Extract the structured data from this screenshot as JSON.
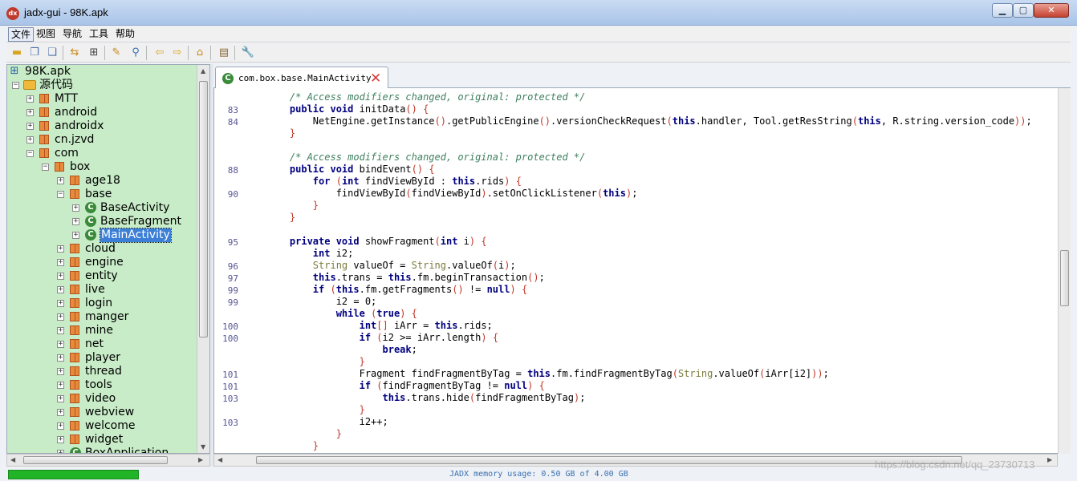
{
  "window": {
    "title": "jadx-gui - 98K.apk",
    "app_icon": "jadx-icon",
    "buttons": {
      "minimize": "▁",
      "maximize": "▢",
      "close": "✕"
    }
  },
  "menu": {
    "items": [
      "文件",
      "视图",
      "导航",
      "工具",
      "帮助"
    ],
    "active": "文件"
  },
  "toolbar": {
    "icons": [
      "open-file-icon",
      "save-all-icon",
      "export-icon",
      "sync-icon",
      "flatten-icon",
      "find-text-icon",
      "search-icon",
      "back-icon",
      "forward-icon",
      "decompile-icon",
      "log-icon",
      "preferences-icon"
    ]
  },
  "tree": {
    "root": "98K.apk",
    "source_folder": "源代码",
    "nodes": [
      {
        "label": "MTT",
        "type": "package",
        "level": 2
      },
      {
        "label": "android",
        "type": "package",
        "level": 2
      },
      {
        "label": "androidx",
        "type": "package",
        "level": 2
      },
      {
        "label": "cn.jzvd",
        "type": "package",
        "level": 2
      },
      {
        "label": "com",
        "type": "package",
        "level": 2,
        "expanded": true
      },
      {
        "label": "box",
        "type": "package",
        "level": 3,
        "expanded": true
      },
      {
        "label": "age18",
        "type": "package",
        "level": 4
      },
      {
        "label": "base",
        "type": "package",
        "level": 4,
        "expanded": true
      },
      {
        "label": "BaseActivity",
        "type": "class",
        "level": 5
      },
      {
        "label": "BaseFragment",
        "type": "class",
        "level": 5
      },
      {
        "label": "MainActivity",
        "type": "class",
        "level": 5,
        "selected": true
      },
      {
        "label": "cloud",
        "type": "package",
        "level": 4
      },
      {
        "label": "engine",
        "type": "package",
        "level": 4
      },
      {
        "label": "entity",
        "type": "package",
        "level": 4
      },
      {
        "label": "live",
        "type": "package",
        "level": 4
      },
      {
        "label": "login",
        "type": "package",
        "level": 4
      },
      {
        "label": "manger",
        "type": "package",
        "level": 4
      },
      {
        "label": "mine",
        "type": "package",
        "level": 4
      },
      {
        "label": "net",
        "type": "package",
        "level": 4
      },
      {
        "label": "player",
        "type": "package",
        "level": 4
      },
      {
        "label": "thread",
        "type": "package",
        "level": 4
      },
      {
        "label": "tools",
        "type": "package",
        "level": 4
      },
      {
        "label": "video",
        "type": "package",
        "level": 4
      },
      {
        "label": "webview",
        "type": "package",
        "level": 4
      },
      {
        "label": "welcome",
        "type": "package",
        "level": 4
      },
      {
        "label": "widget",
        "type": "package",
        "level": 4
      },
      {
        "label": "BoxApplication",
        "type": "class",
        "level": 4
      }
    ]
  },
  "tab": {
    "label": "com.box.base.MainActivity",
    "close_icon": "close-tab-icon"
  },
  "code": [
    {
      "n": "",
      "t": [
        [
          "cm",
          "    /* Access modifiers changed, original: protected */"
        ]
      ]
    },
    {
      "n": "83",
      "t": [
        [
          "",
          "    "
        ],
        [
          "kw",
          "public void"
        ],
        [
          "",
          " initData"
        ],
        [
          "pn",
          "()"
        ],
        [
          "",
          " "
        ],
        [
          "pn",
          "{"
        ]
      ]
    },
    {
      "n": "84",
      "t": [
        [
          "",
          "        NetEngine.getInstance"
        ],
        [
          "pn",
          "()"
        ],
        [
          "",
          ".getPublicEngine"
        ],
        [
          "pn",
          "()"
        ],
        [
          "",
          ".versionCheckRequest"
        ],
        [
          "pn",
          "("
        ],
        [
          "kw",
          "this"
        ],
        [
          "",
          ".handler, Tool.getResString"
        ],
        [
          "pn",
          "("
        ],
        [
          "kw",
          "this"
        ],
        [
          "",
          ", R.string.version_code"
        ],
        [
          "pn",
          "))"
        ],
        [
          "",
          ";"
        ]
      ]
    },
    {
      "n": "",
      "t": [
        [
          "pn",
          "    }"
        ]
      ]
    },
    {
      "n": "",
      "t": [
        [
          "",
          ""
        ]
      ]
    },
    {
      "n": "",
      "t": [
        [
          "cm",
          "    /* Access modifiers changed, original: protected */"
        ]
      ]
    },
    {
      "n": "88",
      "t": [
        [
          "",
          "    "
        ],
        [
          "kw",
          "public void"
        ],
        [
          "",
          " bindEvent"
        ],
        [
          "pn",
          "()"
        ],
        [
          "",
          " "
        ],
        [
          "pn",
          "{"
        ]
      ]
    },
    {
      "n": "",
      "t": [
        [
          "",
          "        "
        ],
        [
          "kw",
          "for"
        ],
        [
          "",
          " "
        ],
        [
          "pn",
          "("
        ],
        [
          "kw",
          "int"
        ],
        [
          "",
          " findViewById : "
        ],
        [
          "kw",
          "this"
        ],
        [
          "",
          ".rids"
        ],
        [
          "pn",
          ")"
        ],
        [
          "",
          " "
        ],
        [
          "pn",
          "{"
        ]
      ]
    },
    {
      "n": "90",
      "t": [
        [
          "",
          "            findViewById"
        ],
        [
          "pn",
          "("
        ],
        [
          "",
          "findViewById"
        ],
        [
          "pn",
          ")"
        ],
        [
          "",
          ".setOnClickListener"
        ],
        [
          "pn",
          "("
        ],
        [
          "kw",
          "this"
        ],
        [
          "pn",
          ")"
        ],
        [
          "",
          ";"
        ]
      ]
    },
    {
      "n": "",
      "t": [
        [
          "pn",
          "        }"
        ]
      ]
    },
    {
      "n": "",
      "t": [
        [
          "pn",
          "    }"
        ]
      ]
    },
    {
      "n": "",
      "t": [
        [
          "",
          ""
        ]
      ]
    },
    {
      "n": "95",
      "t": [
        [
          "",
          "    "
        ],
        [
          "kw",
          "private void"
        ],
        [
          "",
          " showFragment"
        ],
        [
          "pn",
          "("
        ],
        [
          "kw",
          "int"
        ],
        [
          "",
          " i"
        ],
        [
          "pn",
          ")"
        ],
        [
          "",
          " "
        ],
        [
          "pn",
          "{"
        ]
      ]
    },
    {
      "n": "",
      "t": [
        [
          "",
          "        "
        ],
        [
          "kw",
          "int"
        ],
        [
          "",
          " i2;"
        ]
      ]
    },
    {
      "n": "96",
      "t": [
        [
          "",
          "        "
        ],
        [
          "ty",
          "String"
        ],
        [
          "",
          " valueOf = "
        ],
        [
          "ty",
          "String"
        ],
        [
          "",
          ".valueOf"
        ],
        [
          "pn",
          "("
        ],
        [
          "",
          "i"
        ],
        [
          "pn",
          ")"
        ],
        [
          "",
          ";"
        ]
      ]
    },
    {
      "n": "97",
      "t": [
        [
          "",
          "        "
        ],
        [
          "kw",
          "this"
        ],
        [
          "",
          ".trans = "
        ],
        [
          "kw",
          "this"
        ],
        [
          "",
          ".fm.beginTransaction"
        ],
        [
          "pn",
          "()"
        ],
        [
          "",
          ";"
        ]
      ]
    },
    {
      "n": "99",
      "t": [
        [
          "",
          "        "
        ],
        [
          "kw",
          "if"
        ],
        [
          "",
          " "
        ],
        [
          "pn",
          "("
        ],
        [
          "kw",
          "this"
        ],
        [
          "",
          ".fm.getFragments"
        ],
        [
          "pn",
          "()"
        ],
        [
          "",
          " != "
        ],
        [
          "kw",
          "null"
        ],
        [
          "pn",
          ")"
        ],
        [
          "",
          " "
        ],
        [
          "pn",
          "{"
        ]
      ]
    },
    {
      "n": "99",
      "t": [
        [
          "",
          "            i2 = 0;"
        ]
      ]
    },
    {
      "n": "",
      "t": [
        [
          "",
          "            "
        ],
        [
          "kw",
          "while"
        ],
        [
          "",
          " "
        ],
        [
          "pn",
          "("
        ],
        [
          "kw",
          "true"
        ],
        [
          "pn",
          ")"
        ],
        [
          "",
          " "
        ],
        [
          "pn",
          "{"
        ]
      ]
    },
    {
      "n": "100",
      "t": [
        [
          "",
          "                "
        ],
        [
          "kw",
          "int"
        ],
        [
          "pn",
          "[]"
        ],
        [
          "",
          " iArr = "
        ],
        [
          "kw",
          "this"
        ],
        [
          "",
          ".rids;"
        ]
      ]
    },
    {
      "n": "100",
      "t": [
        [
          "",
          "                "
        ],
        [
          "kw",
          "if"
        ],
        [
          "",
          " "
        ],
        [
          "pn",
          "("
        ],
        [
          "",
          "i2 >= iArr.length"
        ],
        [
          "pn",
          ")"
        ],
        [
          "",
          " "
        ],
        [
          "pn",
          "{"
        ]
      ]
    },
    {
      "n": "",
      "t": [
        [
          "",
          "                    "
        ],
        [
          "kw",
          "break"
        ],
        [
          "",
          ";"
        ]
      ]
    },
    {
      "n": "",
      "t": [
        [
          "pn",
          "                }"
        ]
      ]
    },
    {
      "n": "101",
      "t": [
        [
          "",
          "                Fragment findFragmentByTag = "
        ],
        [
          "kw",
          "this"
        ],
        [
          "",
          ".fm.findFragmentByTag"
        ],
        [
          "pn",
          "("
        ],
        [
          "ty",
          "String"
        ],
        [
          "",
          ".valueOf"
        ],
        [
          "pn",
          "("
        ],
        [
          "",
          "iArr[i2]"
        ],
        [
          "pn",
          "))"
        ],
        [
          "",
          ";"
        ]
      ]
    },
    {
      "n": "101",
      "t": [
        [
          "",
          "                "
        ],
        [
          "kw",
          "if"
        ],
        [
          "",
          " "
        ],
        [
          "pn",
          "("
        ],
        [
          "",
          "findFragmentByTag != "
        ],
        [
          "kw",
          "null"
        ],
        [
          "pn",
          ")"
        ],
        [
          "",
          " "
        ],
        [
          "pn",
          "{"
        ]
      ]
    },
    {
      "n": "103",
      "t": [
        [
          "",
          "                    "
        ],
        [
          "kw",
          "this"
        ],
        [
          "",
          ".trans.hide"
        ],
        [
          "pn",
          "("
        ],
        [
          "",
          "findFragmentByTag"
        ],
        [
          "pn",
          ")"
        ],
        [
          "",
          ";"
        ]
      ]
    },
    {
      "n": "",
      "t": [
        [
          "pn",
          "                }"
        ]
      ]
    },
    {
      "n": "103",
      "t": [
        [
          "",
          "                i2++;"
        ]
      ]
    },
    {
      "n": "",
      "t": [
        [
          "pn",
          "            }"
        ]
      ]
    },
    {
      "n": "",
      "t": [
        [
          "pn",
          "        }"
        ]
      ]
    }
  ],
  "status": {
    "memory": "JADX memory usage: 0.50 GB of 4.00 GB",
    "memory_fraction": 0.125
  },
  "watermark": "https://blog.csdn.net/qq_23730713",
  "colors": {
    "tree_bg": "#c8ecc8",
    "keyword": "#00007f",
    "comment": "#3f7f5f",
    "selection": "#3b7fd6",
    "memory_bar": "#22b427"
  }
}
